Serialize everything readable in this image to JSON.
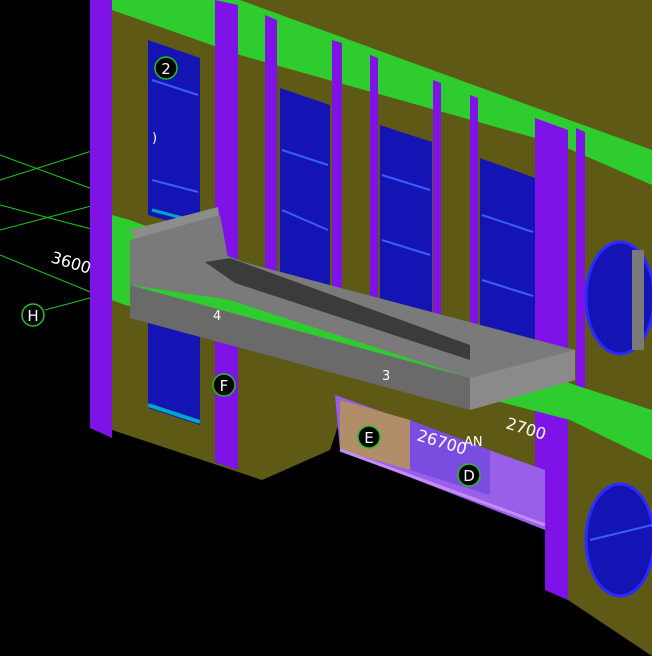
{
  "viewport": {
    "background": "#000000"
  },
  "colors": {
    "wall": "#5e5a16",
    "column": "#7f12e6",
    "slab": "#2ecc2e",
    "glass": "#1414b4",
    "parapet": "#7a7a7a",
    "gridline": "#1fc51f",
    "text": "#ffffff"
  },
  "dimensions": {
    "dim_3600": "3600",
    "dim_26700": "26700",
    "dim_2700": "2700"
  },
  "grid_bubbles": {
    "bubble_2": "2",
    "bubble_H": "H",
    "bubble_F": "F",
    "bubble_E": "E",
    "bubble_D": "D"
  },
  "fragments": {
    "frag_paren": ")",
    "frag_4": "4",
    "frag_3": "3",
    "frag_an": "AN"
  }
}
